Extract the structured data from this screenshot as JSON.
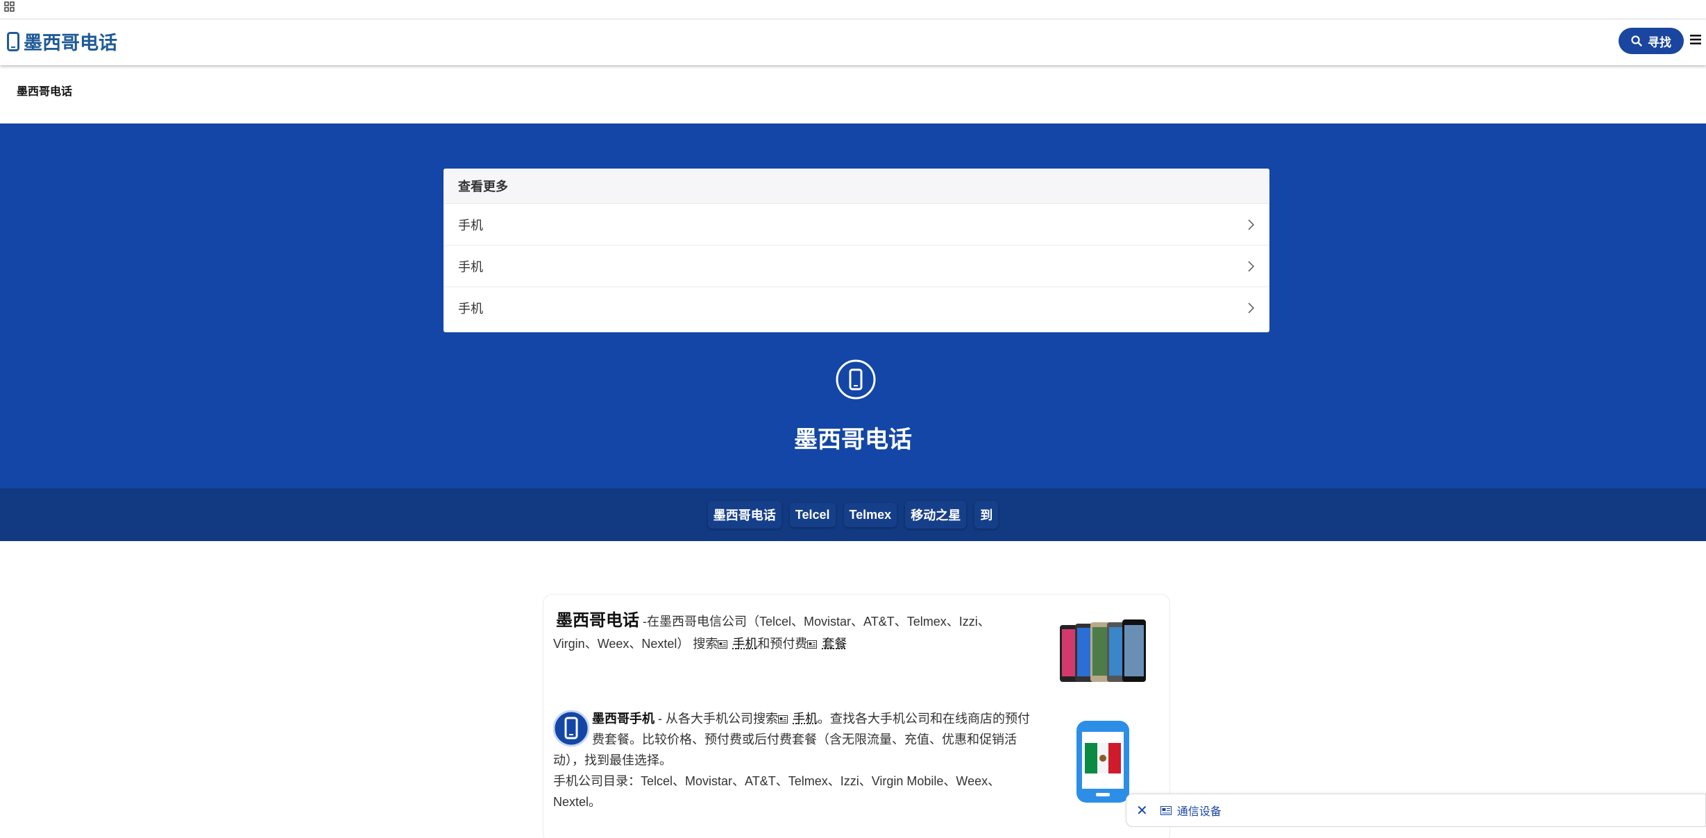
{
  "topbar": {
    "apps_icon": "grid-icon"
  },
  "header": {
    "logo_text": "墨西哥电话",
    "logo_icon": "phone-icon",
    "search_label": "寻找",
    "menu_icon": "hamburger-icon",
    "brand_color": "#1346a6"
  },
  "breadcrumb": "墨西哥电话",
  "more": {
    "title": "查看更多",
    "items": [
      {
        "label": "手机"
      },
      {
        "label": "手机"
      },
      {
        "label": "手机"
      }
    ]
  },
  "hero": {
    "title": "墨西哥电话",
    "icon": "phone-circle-icon"
  },
  "nav": [
    "墨西哥电话",
    "Telcel",
    "Telmex",
    "移动之星",
    "到"
  ],
  "intro": {
    "lead": "墨西哥电话",
    "text_a": " -在墨西哥电信公司（Telcel、Movistar、AT&T、Telmex、Izzi、Virgin、Weex、Nextel） 搜索",
    "link1": "手机",
    "text_b": "和预付费",
    "link2": "套餐"
  },
  "section": {
    "lead": "墨西哥手机",
    "text_a": " - 从各大手机公司搜索",
    "link": "手机",
    "text_b": "。查找各大手机公司和在线商店的预付费套餐。比较价格、预付费或后付费套餐（含无限流量、充值、优惠和促销活动），找到最佳选择。",
    "directory": "手机公司目录：Telcel、Movistar、AT&T、Telmex、Izzi、Virgin Mobile、Weex、Nextel。"
  },
  "toast": {
    "close": "✕",
    "label": "通信设备"
  }
}
